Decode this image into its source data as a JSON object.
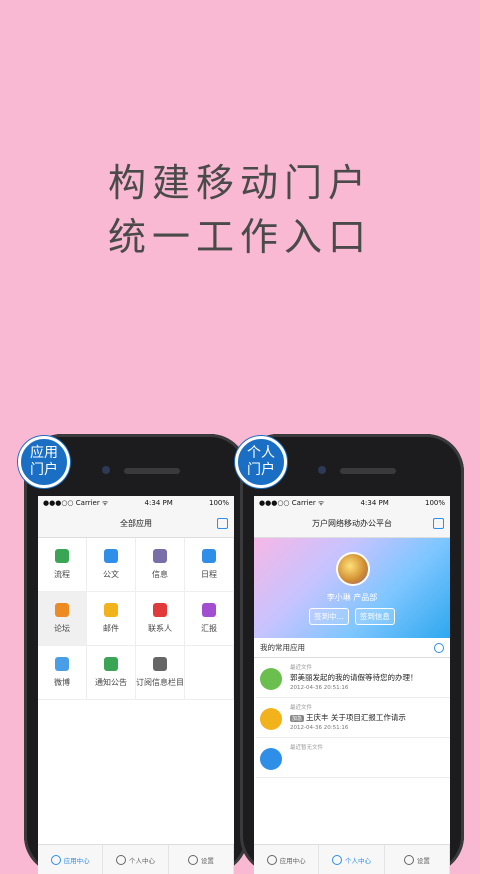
{
  "headline": {
    "line1": "构建移动门户",
    "line2": "统一工作入口"
  },
  "badges": {
    "left": "应用门户",
    "right": "个人门户"
  },
  "status": {
    "carrier": "●●●○○ Carrier ᯤ",
    "time": "4:34 PM",
    "battery": "100%"
  },
  "left_phone": {
    "title": "全部应用",
    "apps": [
      {
        "label": "流程",
        "icon": "share-icon",
        "color": "#3aa655"
      },
      {
        "label": "公文",
        "icon": "briefcase-icon",
        "color": "#2f8ee8"
      },
      {
        "label": "信息",
        "icon": "chat-icon",
        "color": "#7a6ea8"
      },
      {
        "label": "日程",
        "icon": "calendar-icon",
        "color": "#2f8ee8"
      },
      {
        "label": "论坛",
        "icon": "forum-icon",
        "color": "#ee8a22"
      },
      {
        "label": "邮件",
        "icon": "mail-icon",
        "color": "#f2b21b"
      },
      {
        "label": "联系人",
        "icon": "person-icon",
        "color": "#e03a3a"
      },
      {
        "label": "汇报",
        "icon": "report-icon",
        "color": "#a24ed1"
      },
      {
        "label": "微博",
        "icon": "people-icon",
        "color": "#4a9ee8"
      },
      {
        "label": "通知公告",
        "icon": "megaphone-icon",
        "color": "#3aa655"
      },
      {
        "label": "订阅信息栏目",
        "icon": "plus-box-icon",
        "color": "#666666"
      },
      {
        "label": "",
        "icon": "",
        "color": ""
      }
    ],
    "tabs": [
      {
        "label": "应用中心",
        "icon": "apps-icon",
        "active": true
      },
      {
        "label": "个人中心",
        "icon": "user-icon",
        "active": false
      },
      {
        "label": "设置",
        "icon": "gear-icon",
        "active": false
      }
    ]
  },
  "right_phone": {
    "title": "万户网络移动办公平台",
    "user": "李小琳    产品部",
    "checkin": "签到中...",
    "checkinfo": "签到信息",
    "section": "我的常用应用",
    "items": [
      {
        "tag": "最近文件",
        "title": "郭美丽发起的我的请假等待您的办理！",
        "date": "2012-04-36   20:51:16",
        "color": "#6bbf4e",
        "pill": ""
      },
      {
        "tag": "最近文件",
        "title": "王庆丰  关于项目汇报工作请示",
        "date": "2012-04-36   20:51:16",
        "color": "#f2b21b",
        "pill": "加急"
      },
      {
        "tag": "最近暂无文件",
        "title": "",
        "date": "",
        "color": "#2f8ee8",
        "pill": ""
      }
    ],
    "tabs": [
      {
        "label": "应用中心",
        "icon": "apps-icon",
        "active": false
      },
      {
        "label": "个人中心",
        "icon": "user-icon",
        "active": true
      },
      {
        "label": "设置",
        "icon": "gear-icon",
        "active": false
      }
    ]
  }
}
